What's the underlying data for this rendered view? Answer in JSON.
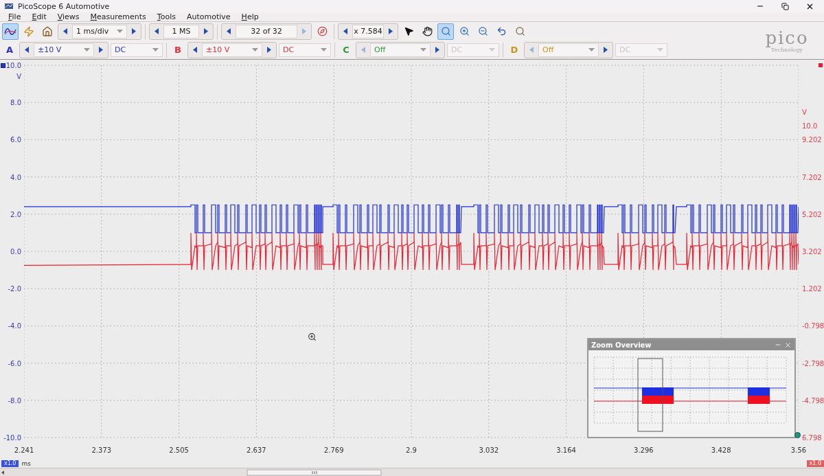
{
  "window": {
    "title": "PicoScope 6 Automotive"
  },
  "menu": [
    {
      "label": "File",
      "mnemonic": true
    },
    {
      "label": "Edit",
      "mnemonic": true
    },
    {
      "label": "Views",
      "mnemonic": true
    },
    {
      "label": "Measurements",
      "mnemonic": true
    },
    {
      "label": "Tools",
      "mnemonic": true
    },
    {
      "label": "Automotive",
      "mnemonic": false
    },
    {
      "label": "Help",
      "mnemonic": true
    }
  ],
  "mode_buttons": [
    {
      "kind": "scope",
      "selected": true
    },
    {
      "kind": "probe",
      "selected": false
    },
    {
      "kind": "home",
      "selected": false
    }
  ],
  "timebase": "1 ms/div",
  "samples": "1 MS",
  "buffer": {
    "value": "32 of 32",
    "next_disabled": true
  },
  "zoom_factor": "x 7.584",
  "tools": [
    {
      "kind": "pointer",
      "selected": false
    },
    {
      "kind": "hand",
      "selected": false
    },
    {
      "kind": "zoom-box",
      "selected": true
    },
    {
      "kind": "zoom-in",
      "selected": false
    },
    {
      "kind": "zoom-out",
      "selected": false
    },
    {
      "kind": "undo",
      "selected": false
    },
    {
      "kind": "zoom-fit",
      "selected": false
    }
  ],
  "logo": {
    "name": "pico",
    "sub": "Technology"
  },
  "channels": [
    {
      "label": "A",
      "color": "#2a35c8",
      "range": "±10 V",
      "coupling": "DC",
      "enabled": true
    },
    {
      "label": "B",
      "color": "#e0303a",
      "range": "±10 V",
      "coupling": "DC",
      "enabled": true
    },
    {
      "label": "C",
      "color": "#2e9a3a",
      "range": "Off",
      "coupling": "DC",
      "enabled": false
    },
    {
      "label": "D",
      "color": "#c8961e",
      "range": "Off",
      "coupling": "DC",
      "enabled": false
    }
  ],
  "left_axis": {
    "unit": "V",
    "ticks": [
      "10.0",
      "8.0",
      "6.0",
      "4.0",
      "2.0",
      "0.0",
      "-2.0",
      "-4.0",
      "-6.0",
      "-8.0",
      "-10.0"
    ]
  },
  "right_axis": {
    "unit": "V",
    "ticks": [
      "10.0",
      "9.202",
      "7.202",
      "5.202",
      "3.202",
      "1.202",
      "-0.798",
      "-2.798",
      "-4.798",
      "6.798"
    ],
    "scale": "x1.0"
  },
  "x_axis": {
    "ticks": [
      "2.241",
      "2.373",
      "2.505",
      "2.637",
      "2.769",
      "2.9",
      "3.032",
      "3.164",
      "3.296",
      "3.428",
      "3.56"
    ],
    "unit": "ms",
    "scale": "x1.0"
  },
  "zoom_overview": {
    "title": "Zoom Overview"
  }
}
